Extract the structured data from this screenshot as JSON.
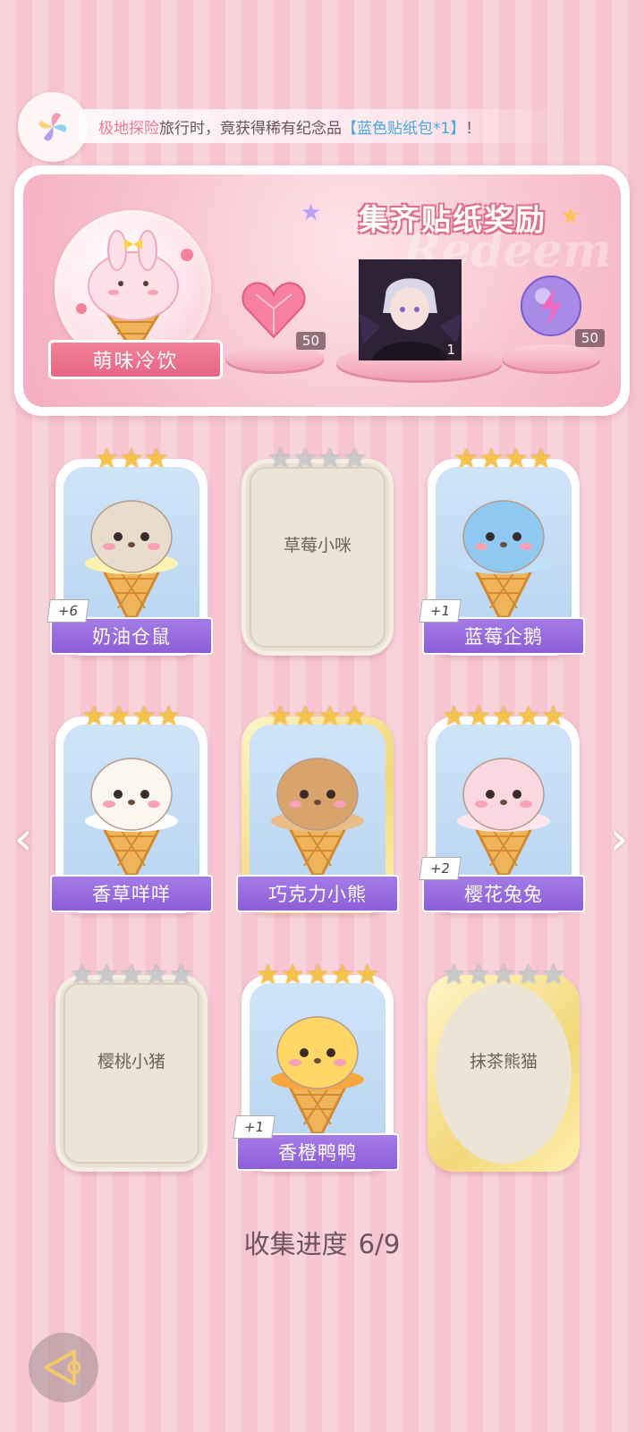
{
  "notice": {
    "part1": "极地探险",
    "part2": "旅行时，竟获得稀有纪念品",
    "part3": "【蓝色贴纸包*1】",
    "part4": "！"
  },
  "reward_panel": {
    "title": "集齐贴纸奖励",
    "watermark": "Redeem",
    "featured_label": "萌味冷饮",
    "rewards": [
      {
        "icon": "heart-gem-icon",
        "count": "50"
      },
      {
        "icon": "character-portrait",
        "count": "1"
      },
      {
        "icon": "lightning-orb-icon",
        "count": "50"
      }
    ]
  },
  "cards": [
    {
      "name": "奶油仓鼠",
      "stars": 3,
      "max_stars": 3,
      "collected": true,
      "dup": "+6",
      "mascot": "hamster"
    },
    {
      "name": "草莓小咪",
      "stars": 0,
      "max_stars": 4,
      "collected": false,
      "dup": "",
      "mascot": ""
    },
    {
      "name": "蓝莓企鹅",
      "stars": 4,
      "max_stars": 4,
      "collected": true,
      "dup": "+1",
      "mascot": "penguin"
    },
    {
      "name": "香草咩咩",
      "stars": 4,
      "max_stars": 4,
      "collected": true,
      "dup": "",
      "mascot": "sheep"
    },
    {
      "name": "巧克力小熊",
      "stars": 4,
      "max_stars": 4,
      "collected": true,
      "dup": "",
      "mascot": "bear"
    },
    {
      "name": "樱花兔兔",
      "stars": 5,
      "max_stars": 5,
      "collected": true,
      "dup": "+2",
      "mascot": "bunny"
    },
    {
      "name": "樱桃小猪",
      "stars": 0,
      "max_stars": 5,
      "collected": false,
      "dup": "",
      "mascot": ""
    },
    {
      "name": "香橙鸭鸭",
      "stars": 5,
      "max_stars": 5,
      "collected": true,
      "dup": "+1",
      "mascot": "duck"
    },
    {
      "name": "抹茶熊猫",
      "stars": 0,
      "max_stars": 5,
      "collected": false,
      "dup": "",
      "mascot": ""
    }
  ],
  "progress": {
    "label": "收集进度",
    "value": "6/9"
  },
  "nav": {
    "prev": "‹",
    "next": "›"
  }
}
